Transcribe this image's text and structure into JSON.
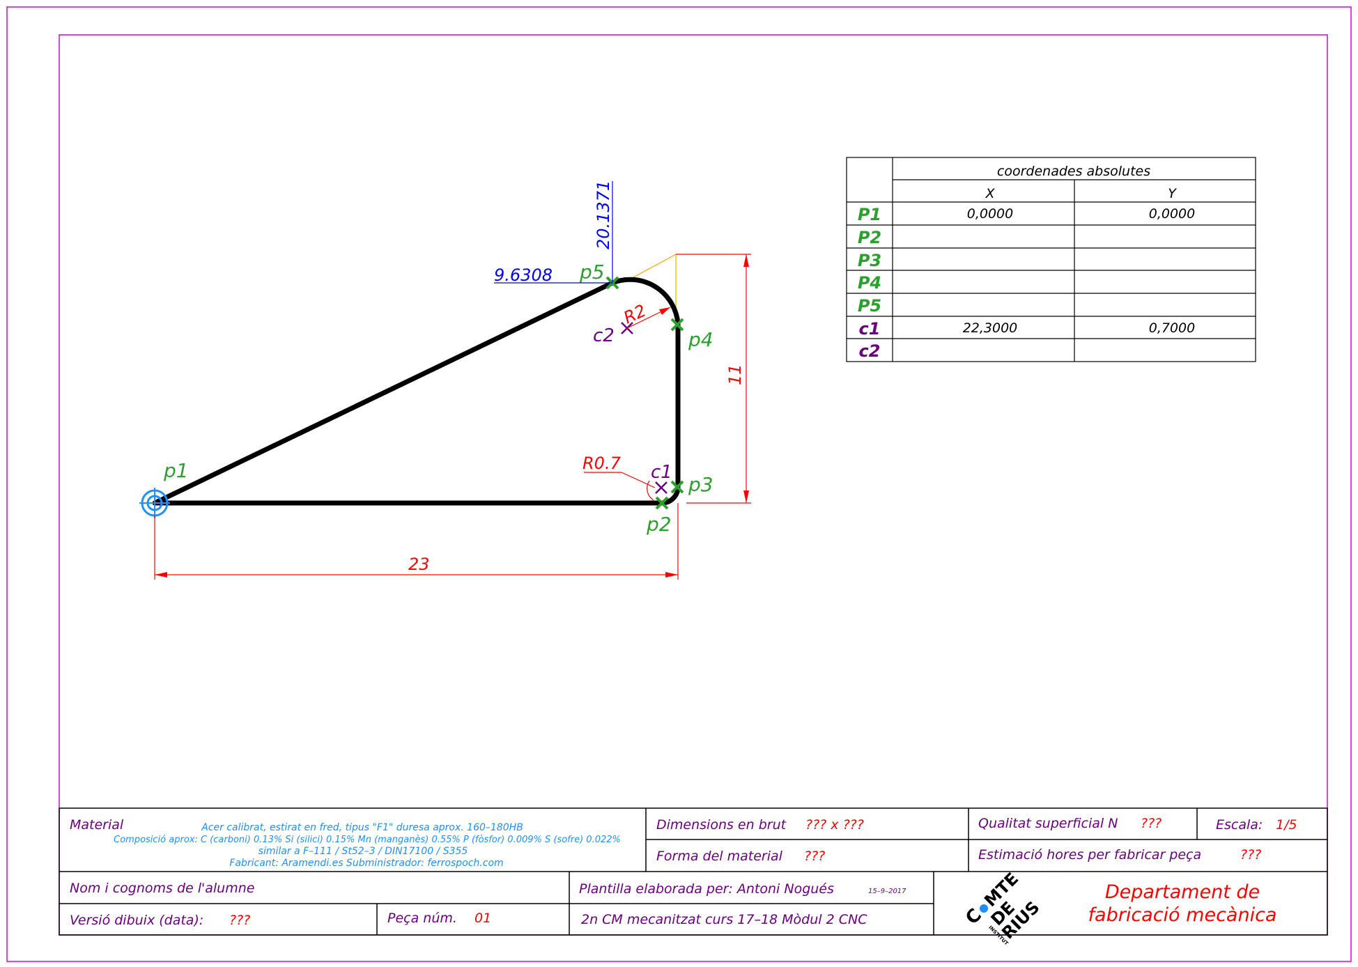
{
  "drawing": {
    "points": {
      "p1": "p1",
      "p2": "p2",
      "p3": "p3",
      "p4": "p4",
      "p5": "p5",
      "c1": "c1",
      "c2": "c2"
    },
    "dimensions": {
      "bottom_length": "23",
      "right_height": "11",
      "radius_small": "R0.7",
      "radius_large": "R2",
      "p5_x": "9.6308",
      "p5_y": "20.1371"
    }
  },
  "coords_table": {
    "header": "coordenades absolutes",
    "col_x": "X",
    "col_y": "Y",
    "rows": [
      {
        "label": "P1",
        "x": "0,0000",
        "y": "0,0000"
      },
      {
        "label": "P2",
        "x": "",
        "y": ""
      },
      {
        "label": "P3",
        "x": "",
        "y": ""
      },
      {
        "label": "P4",
        "x": "",
        "y": ""
      },
      {
        "label": "P5",
        "x": "",
        "y": ""
      },
      {
        "label": "c1",
        "x": "22,3000",
        "y": "0,7000"
      },
      {
        "label": "c2",
        "x": "",
        "y": ""
      }
    ]
  },
  "title_block": {
    "material_label": "Material",
    "material_line1": "Acer calibrat, estirat en fred, tipus \"F1\" duresa aprox. 160–180HB",
    "material_line2": "Composició aprox: C (carboni) 0.13% Si (silici) 0.15% Mn (manganès) 0.55% P (fòsfor) 0.009% S (sofre) 0.022%",
    "material_line3": "similar a F–111 / St52–3 / DIN17100 / S355",
    "material_line4": "Fabricant: Aramendi.es Subministrador: ferrospoch.com",
    "dimensions_label": "Dimensions en brut",
    "dimensions_value": "??? x ???",
    "forma_label": "Forma del material",
    "forma_value": "???",
    "qualitat_label": "Qualitat superficial N",
    "qualitat_value": "???",
    "escala_label": "Escala:",
    "escala_value": "1/5",
    "hores_label": "Estimació hores per fabricar peça",
    "hores_value": "???",
    "nom_label": "Nom i cognoms de l'alumne",
    "versio_label": "Versió dibuix (data):",
    "versio_value": "???",
    "peca_label": "Peça núm.",
    "peca_value": "01",
    "plantilla_label": "Plantilla elaborada per: Antoni Nogués",
    "plantilla_date": "15–9–2017",
    "curs": "2n CM mecanitzat curs 17–18 Mòdul 2 CNC",
    "logo_text": "COMTE DE RIUS INSTITUT",
    "dept_line1": "Departament de",
    "dept_line2": "fabricació mecànica"
  },
  "colors": {
    "frame": "#e000e0",
    "geometry": "#000000",
    "dimension": "#ff0000",
    "point_label": "#2ca02c",
    "center_label": "#6a0080",
    "coord_dim": "#0000ff",
    "origin": "#1e90ff",
    "construction": "#f5a500",
    "material_text": "#1e90ff"
  }
}
